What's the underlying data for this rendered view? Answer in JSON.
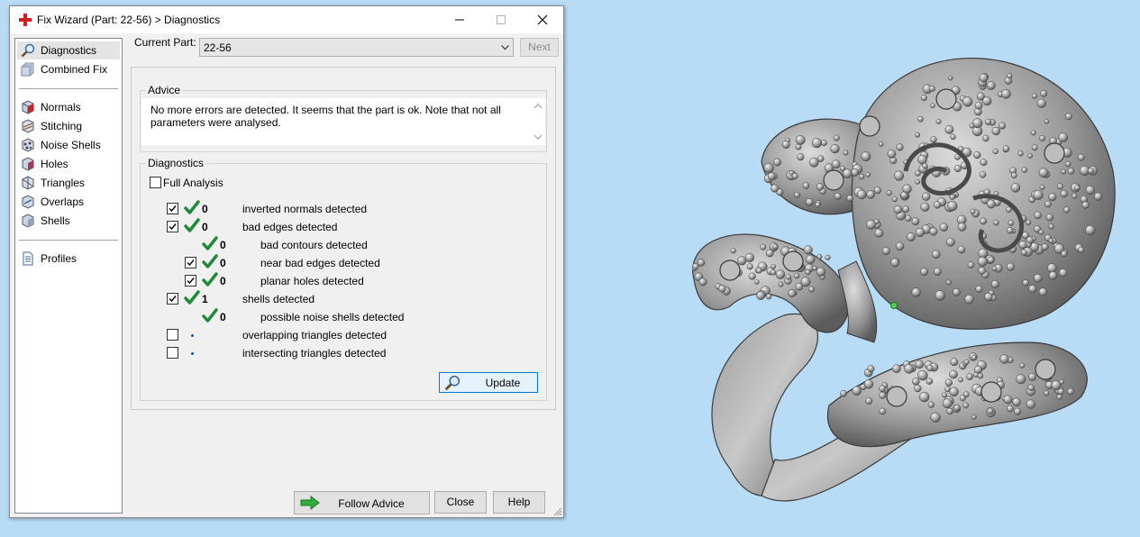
{
  "window": {
    "title": "Fix Wizard (Part: 22-56) > Diagnostics",
    "controls": [
      "minimize-icon",
      "maximize-icon",
      "close-icon"
    ]
  },
  "sidebar": {
    "items": [
      {
        "label": "Diagnostics",
        "icon": "magnifier-icon",
        "selected": true
      },
      {
        "label": "Combined Fix",
        "icon": "stacked-pages-icon"
      },
      {
        "label": "Normals",
        "icon": "red-cube-icon"
      },
      {
        "label": "Stitching",
        "icon": "stitching-cube-icon"
      },
      {
        "label": "Noise Shells",
        "icon": "noise-shells-icon"
      },
      {
        "label": "Holes",
        "icon": "holes-cube-icon"
      },
      {
        "label": "Triangles",
        "icon": "triangles-cube-icon"
      },
      {
        "label": "Overlaps",
        "icon": "overlaps-cube-icon"
      },
      {
        "label": "Shells",
        "icon": "shells-cube-icon"
      },
      {
        "label": "Profiles",
        "icon": "document-icon"
      }
    ]
  },
  "part": {
    "label": "Current Part:",
    "value": "22-56",
    "next_label": "Next"
  },
  "advice": {
    "title": "Advice",
    "line1": "No more errors are detected. It seems that the part is ok. Note that not all",
    "line2": "parameters were analysed."
  },
  "diagnostics": {
    "title": "Diagnostics",
    "full_analysis_label": "Full Analysis",
    "full_analysis_checked": false,
    "rows": [
      {
        "checkbox": true,
        "checked": true,
        "status": "ok",
        "count": "0",
        "label": "inverted normals detected",
        "indent": 0
      },
      {
        "checkbox": true,
        "checked": true,
        "status": "ok",
        "count": "0",
        "label": "bad edges detected",
        "indent": 0
      },
      {
        "checkbox": false,
        "checked": false,
        "status": "ok",
        "count": "0",
        "label": "bad contours detected",
        "indent": 1
      },
      {
        "checkbox": true,
        "checked": true,
        "status": "ok",
        "count": "0",
        "label": "near bad edges detected",
        "indent": 1
      },
      {
        "checkbox": true,
        "checked": true,
        "status": "ok",
        "count": "0",
        "label": "planar holes detected",
        "indent": 1
      },
      {
        "checkbox": true,
        "checked": true,
        "status": "ok",
        "count": "1",
        "label": "shells detected",
        "indent": 0
      },
      {
        "checkbox": false,
        "checked": false,
        "status": "ok",
        "count": "0",
        "label": "possible noise shells detected",
        "indent": 1
      },
      {
        "checkbox": true,
        "checked": false,
        "status": "not-analysed",
        "count": "",
        "label": "overlapping triangles detected",
        "indent": 0
      },
      {
        "checkbox": true,
        "checked": false,
        "status": "not-analysed",
        "count": "",
        "label": "intersecting triangles detected",
        "indent": 0
      }
    ],
    "update_label": "Update"
  },
  "footer": {
    "follow_advice_label": "Follow Advice",
    "close_label": "Close",
    "help_label": "Help"
  },
  "colors": {
    "desktop": "#b9dcf6",
    "tick_green": "#1f8a3a",
    "app_icon_red": "#d42020",
    "selection": "#e4e4e4",
    "focus_blue": "#0078d7"
  }
}
